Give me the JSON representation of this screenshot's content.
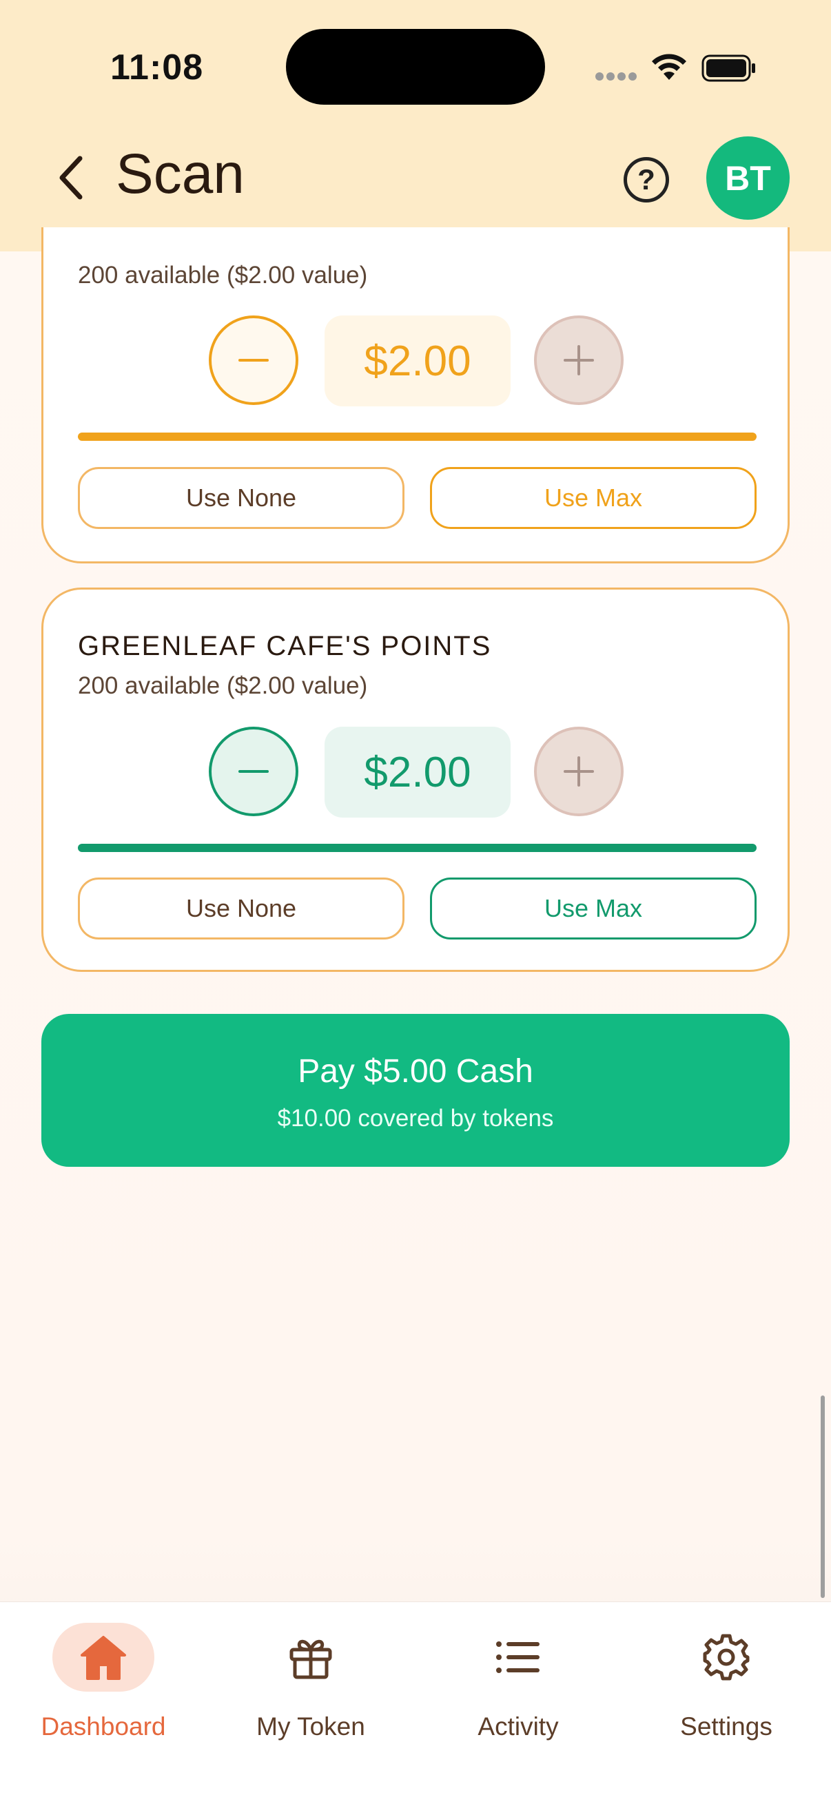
{
  "status_bar": {
    "time": "11:08"
  },
  "header": {
    "title": "Scan",
    "help_symbol": "?",
    "avatar_initials": "BT"
  },
  "cards": [
    {
      "available": "200 available ($2.00 value)",
      "amount": "$2.00",
      "use_none_label": "Use None",
      "use_max_label": "Use Max",
      "progress_percent": 100,
      "accent_color": "#F0A21B"
    },
    {
      "title": "GREENLEAF CAFE'S POINTS",
      "available": "200 available ($2.00 value)",
      "amount": "$2.00",
      "use_none_label": "Use None",
      "use_max_label": "Use Max",
      "progress_percent": 100,
      "accent_color": "#129A6C"
    }
  ],
  "pay_button": {
    "label": "Pay $5.00 Cash",
    "sublabel": "$10.00 covered by tokens",
    "color": "#12BA82"
  },
  "tabs": [
    {
      "label": "Dashboard",
      "icon": "home-icon",
      "active": true
    },
    {
      "label": "My Token",
      "icon": "gift-icon",
      "active": false
    },
    {
      "label": "Activity",
      "icon": "list-icon",
      "active": false
    },
    {
      "label": "Settings",
      "icon": "gear-icon",
      "active": false
    }
  ],
  "colors": {
    "header_bg": "#FDEBC8",
    "active_tab": "#E5683D",
    "avatar_bg": "#14B97D"
  }
}
